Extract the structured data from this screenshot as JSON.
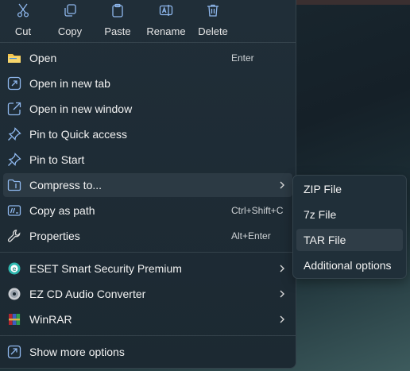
{
  "toolbar": {
    "cut": "Cut",
    "copy": "Copy",
    "paste": "Paste",
    "rename": "Rename",
    "delete": "Delete"
  },
  "menu": {
    "open": {
      "label": "Open",
      "shortcut": "Enter"
    },
    "open_new_tab": "Open in new tab",
    "open_new_window": "Open in new window",
    "pin_quick_access": "Pin to Quick access",
    "pin_start": "Pin to Start",
    "compress": "Compress to...",
    "copy_path": {
      "label": "Copy as path",
      "shortcut": "Ctrl+Shift+C"
    },
    "properties": {
      "label": "Properties",
      "shortcut": "Alt+Enter"
    },
    "eset": "ESET Smart Security Premium",
    "ezcd": "EZ CD Audio Converter",
    "winrar": "WinRAR",
    "show_more": "Show more options"
  },
  "submenu": {
    "zip": "ZIP File",
    "sevenz": "7z File",
    "tar": "TAR File",
    "additional": "Additional options"
  },
  "icons": {
    "accent": "#8fb8ee",
    "folder": "#f3c24a"
  }
}
